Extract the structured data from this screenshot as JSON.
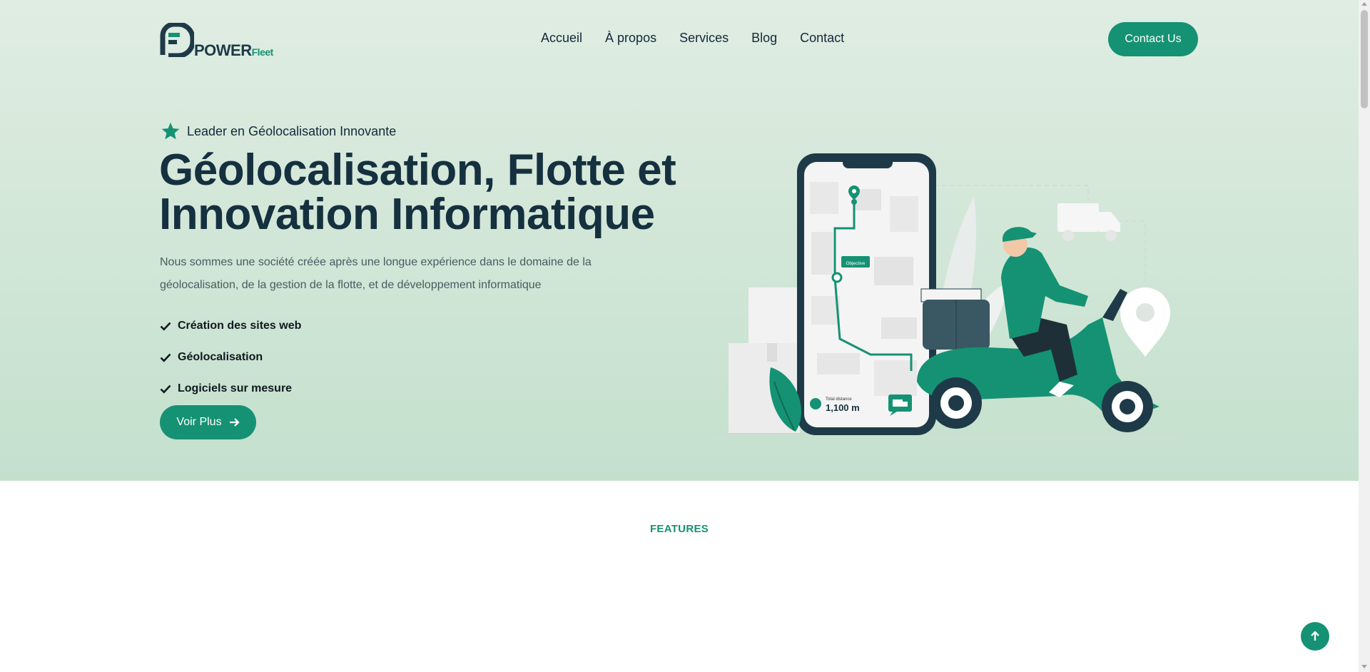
{
  "brand": {
    "name_main": "POWER",
    "name_sub": "Fleet",
    "accent_color": "#159273",
    "title_color": "#15303f"
  },
  "nav": {
    "items": [
      {
        "label": "Accueil"
      },
      {
        "label": "À propos"
      },
      {
        "label": "Services"
      },
      {
        "label": "Blog"
      },
      {
        "label": "Contact"
      }
    ],
    "cta_label": "Contact Us"
  },
  "hero": {
    "tagline": "Leader en Géolocalisation Innovante",
    "tagline_icon": "star-icon",
    "title": "Géolocalisation, Flotte et Innovation Informatique",
    "description": "Nous sommes une société créée après une longue expérience dans le domaine de la géolocalisation, de la gestion de la flotte, et de développement informatique",
    "features": [
      {
        "label": "Création des sites web"
      },
      {
        "label": "Géolocalisation"
      },
      {
        "label": "Logiciels sur mesure"
      }
    ],
    "button_label": "Voir Plus",
    "illustration": {
      "route_label": "Objective",
      "distance_label": "Total distance",
      "distance_value": "1,100 m"
    }
  },
  "features_section": {
    "label": "FEATURES"
  }
}
